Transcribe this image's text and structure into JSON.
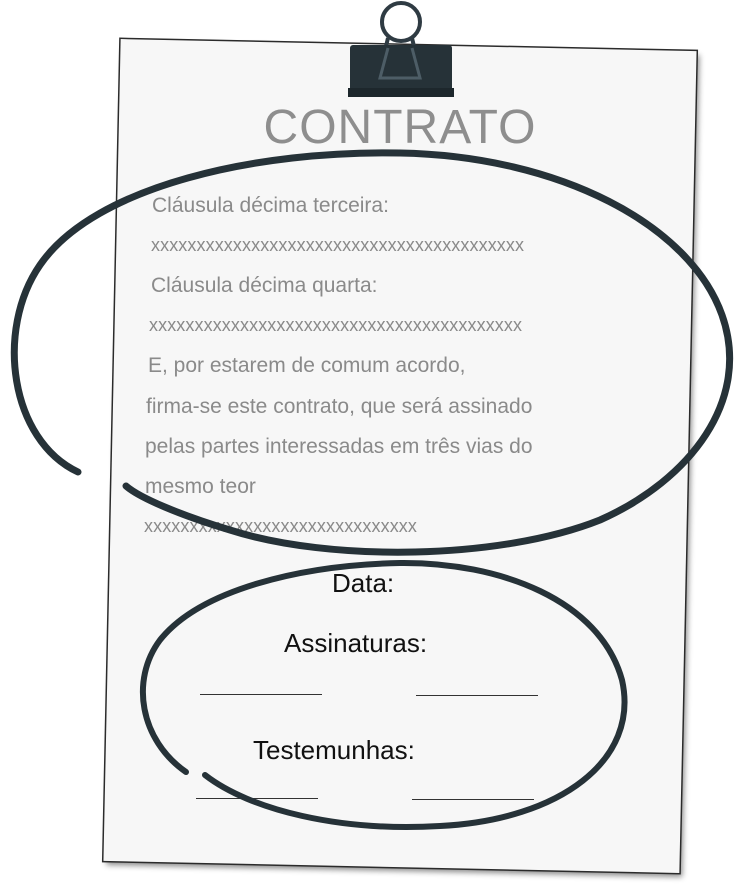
{
  "document": {
    "title": "CONTRATO",
    "clause_13_heading": "Cláusula décima terceira:",
    "clause_13_text": "xxxxxxxxxxxxxxxxxxxxxxxxxxxxxxxxxxxxxxxxx",
    "clause_14_heading": "Cláusula décima quarta:",
    "clause_14_text": "xxxxxxxxxxxxxxxxxxxxxxxxxxxxxxxxxxxxxxxxx",
    "closing_lines": [
      "E, por estarem de comum acordo,",
      "firma-se este contrato, que será assinado",
      "pelas partes interessadas em três vias do",
      "mesmo teor"
    ],
    "closing_x": "xxxxxxxxxxxxxxxxxxxxxxxxxxxxxx"
  },
  "signature_block": {
    "date_label": "Data:",
    "signatures_label": "Assinaturas:",
    "witnesses_label": "Testemunhas:"
  },
  "icons": {
    "clip": "binder-clip-icon",
    "upper_mark": "hand-drawn-ellipse-upper",
    "lower_mark": "hand-drawn-ellipse-lower"
  },
  "colors": {
    "paper": "#f7f7f7",
    "ink": "#263238",
    "title": "#8e8e8e",
    "body_text": "#8a8a8a"
  }
}
